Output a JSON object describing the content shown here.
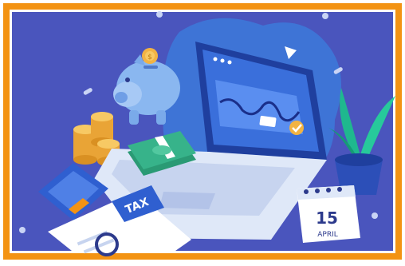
{
  "illustration": {
    "tax_form_label": "TAX",
    "calendar_day": "15",
    "calendar_month": "APRIL",
    "coin_symbol": "$"
  },
  "colors": {
    "border_orange": "#f39313",
    "background": "#4a55bd",
    "blob": "#3e74d6",
    "laptop_body": "#dfe8f8",
    "laptop_screen": "#3a6fdb",
    "cash": "#37b38a",
    "coins": "#f2b343",
    "piggy": "#8ab7f0",
    "plant": "#1fb88e",
    "calculator": "#2f5fd0"
  }
}
